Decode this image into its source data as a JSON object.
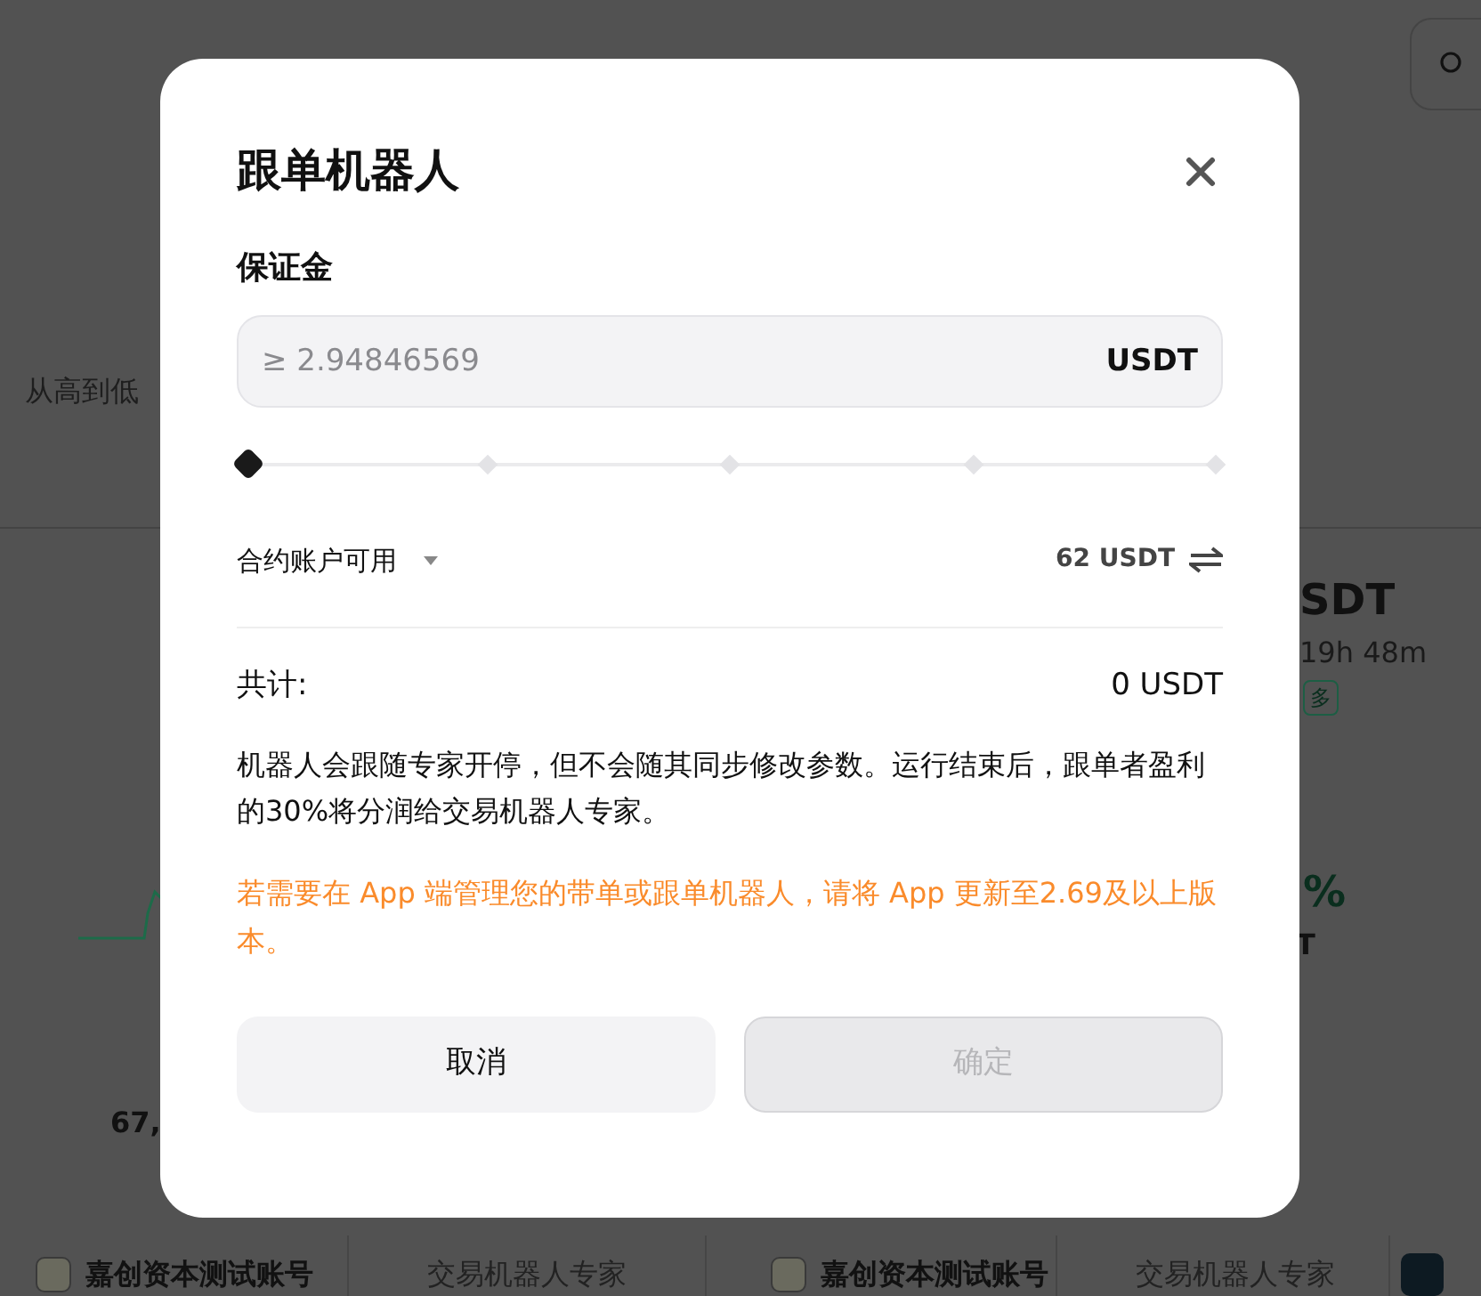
{
  "background": {
    "sort_label": "从高到低",
    "left_card": {
      "value": "67,"
    },
    "right_card": {
      "pair": "SDT",
      "duration": "19h 48m",
      "direction_tag": "多",
      "roi": "%",
      "amount": "T"
    },
    "footer": [
      {
        "kind": "account",
        "name": "嘉创资本测试账号"
      },
      {
        "kind": "role",
        "name": "交易机器人专家"
      },
      {
        "kind": "account",
        "name": "嘉创资本测试账号"
      },
      {
        "kind": "role",
        "name": "交易机器人专家"
      },
      {
        "kind": "logo"
      }
    ]
  },
  "dialog": {
    "title": "跟单机器人",
    "margin_label": "保证金",
    "margin_field": {
      "placeholder": "≥ 2.94846569",
      "unit": "USDT"
    },
    "slider": {
      "level": 0
    },
    "account": {
      "label": "合约账户可用",
      "value": "62 USDT"
    },
    "total": {
      "label": "共计:",
      "value": "0 USDT"
    },
    "note": "机器人会跟随专家开停，但不会随其同步修改参数。运行结束后，跟单者盈利的30%将分润给交易机器人专家。",
    "warning": "若需要在 App 端管理您的带单或跟单机器人，请将 App 更新至2.69及以上版本。",
    "buttons": [
      {
        "label": "取消",
        "kind": "secondary",
        "disabled": false
      },
      {
        "label": "确定",
        "kind": "primary",
        "disabled": true
      }
    ]
  }
}
